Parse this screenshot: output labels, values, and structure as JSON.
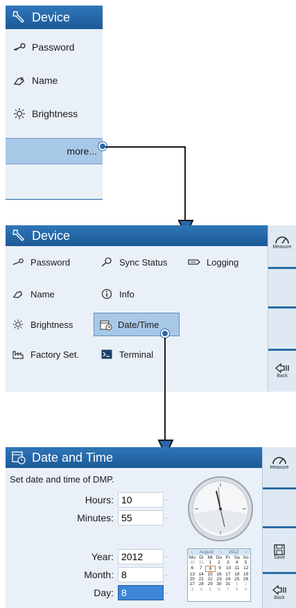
{
  "device_menu": {
    "title": "Device",
    "items": [
      {
        "label": "Password",
        "icon": "key-icon"
      },
      {
        "label": "Name",
        "icon": "tag-icon"
      },
      {
        "label": "Brightness",
        "icon": "sun-icon"
      }
    ],
    "more_label": "more..."
  },
  "device_grid": {
    "title": "Device",
    "col1": [
      "Password",
      "Name",
      "Brightness",
      "Factory Set."
    ],
    "col2": [
      "Sync Status",
      "Info",
      "Date/Time",
      "Terminal"
    ],
    "col3": [
      "Logging"
    ]
  },
  "sidebar": {
    "measure": "Measure",
    "back": "Back",
    "save": "Save"
  },
  "datetime": {
    "title": "Date and Time",
    "description": "Set date and time of DMP.",
    "hours_label": "Hours:",
    "hours_value": "10",
    "minutes_label": "Minutes:",
    "minutes_value": "55",
    "year_label": "Year:",
    "year_value": "2012",
    "month_label": "Month:",
    "month_value": "8",
    "day_label": "Day:",
    "day_value": "8"
  },
  "calendar": {
    "month": "August",
    "year": "2012",
    "weekdays": [
      "Mo",
      "Di",
      "Mi",
      "Do",
      "Fr",
      "Sa",
      "So"
    ],
    "weeks": [
      [
        "30",
        "31",
        "1",
        "2",
        "3",
        "4",
        "5"
      ],
      [
        "6",
        "7",
        "8",
        "9",
        "10",
        "11",
        "12"
      ],
      [
        "13",
        "14",
        "15",
        "16",
        "17",
        "18",
        "19"
      ],
      [
        "20",
        "21",
        "22",
        "23",
        "24",
        "25",
        "26"
      ],
      [
        "27",
        "28",
        "29",
        "30",
        "31",
        "1",
        "2"
      ],
      [
        "3",
        "4",
        "5",
        "6",
        "7",
        "8",
        "9"
      ]
    ]
  },
  "colors": {
    "title_bar": "#1f5f9e",
    "panel_bg": "#e9f0f7",
    "highlight": "#a8c8e8",
    "active_input": "#3e86d6"
  }
}
